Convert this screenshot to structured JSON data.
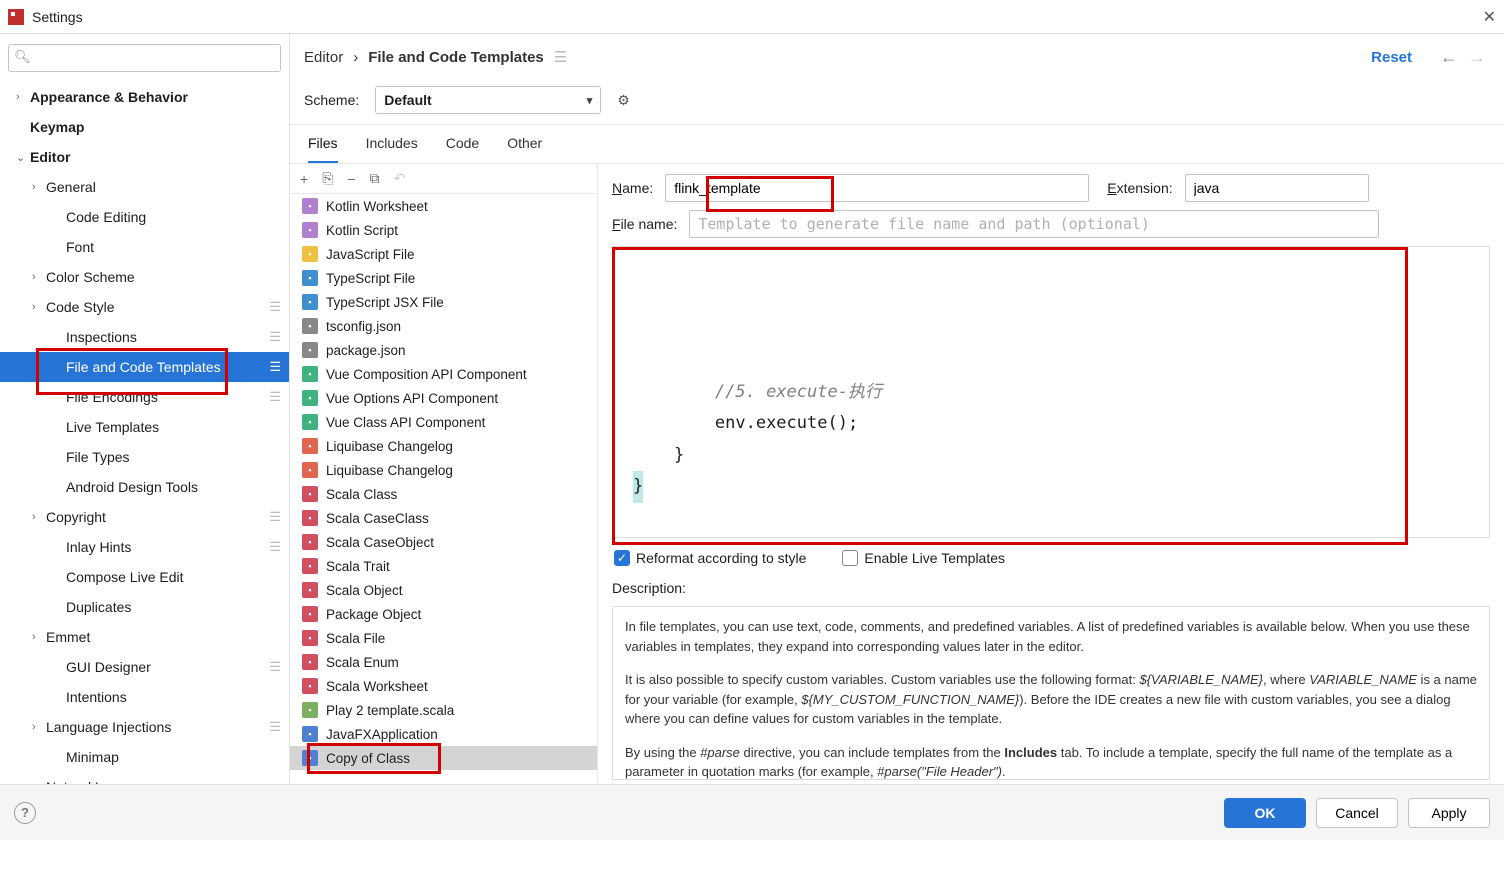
{
  "window": {
    "title": "Settings",
    "close": "✕"
  },
  "header": {
    "breadcrumb_root": "Editor",
    "breadcrumb_current": "File and Code Templates",
    "reset": "Reset"
  },
  "scheme": {
    "label": "Scheme:",
    "value": "Default"
  },
  "tabs": [
    {
      "label": "Files",
      "selected": true
    },
    {
      "label": "Includes",
      "selected": false
    },
    {
      "label": "Code",
      "selected": false
    },
    {
      "label": "Other",
      "selected": false
    }
  ],
  "sidebar": {
    "search_placeholder": "",
    "items": [
      {
        "label": "Appearance & Behavior",
        "depth": 0,
        "chev": "›",
        "bold": true
      },
      {
        "label": "Keymap",
        "depth": 0,
        "chev": "",
        "bold": true
      },
      {
        "label": "Editor",
        "depth": 0,
        "chev": "⌄",
        "bold": true
      },
      {
        "label": "General",
        "depth": 1,
        "chev": "›"
      },
      {
        "label": "Code Editing",
        "depth": 2,
        "chev": ""
      },
      {
        "label": "Font",
        "depth": 2,
        "chev": ""
      },
      {
        "label": "Color Scheme",
        "depth": 1,
        "chev": "›"
      },
      {
        "label": "Code Style",
        "depth": 1,
        "chev": "›",
        "badge": "☰"
      },
      {
        "label": "Inspections",
        "depth": 2,
        "chev": "",
        "badge": "☰"
      },
      {
        "label": "File and Code Templates",
        "depth": 2,
        "chev": "",
        "selected": true,
        "badge": "☰"
      },
      {
        "label": "File Encodings",
        "depth": 2,
        "chev": "",
        "badge": "☰"
      },
      {
        "label": "Live Templates",
        "depth": 2,
        "chev": ""
      },
      {
        "label": "File Types",
        "depth": 2,
        "chev": ""
      },
      {
        "label": "Android Design Tools",
        "depth": 2,
        "chev": ""
      },
      {
        "label": "Copyright",
        "depth": 1,
        "chev": "›",
        "badge": "☰"
      },
      {
        "label": "Inlay Hints",
        "depth": 2,
        "chev": "",
        "badge": "☰"
      },
      {
        "label": "Compose Live Edit",
        "depth": 2,
        "chev": ""
      },
      {
        "label": "Duplicates",
        "depth": 2,
        "chev": ""
      },
      {
        "label": "Emmet",
        "depth": 1,
        "chev": "›"
      },
      {
        "label": "GUI Designer",
        "depth": 2,
        "chev": "",
        "badge": "☰"
      },
      {
        "label": "Intentions",
        "depth": 2,
        "chev": ""
      },
      {
        "label": "Language Injections",
        "depth": 1,
        "chev": "›",
        "badge": "☰"
      },
      {
        "label": "Minimap",
        "depth": 2,
        "chev": ""
      },
      {
        "label": "Natural Languages",
        "depth": 1,
        "chev": "›"
      }
    ]
  },
  "template_toolbar": {
    "add": "+",
    "dup": "⎘",
    "remove": "−",
    "copy": "⧉",
    "undo": "↶"
  },
  "templates": [
    {
      "label": "Kotlin Worksheet",
      "color": "#b07fd0"
    },
    {
      "label": "Kotlin Script",
      "color": "#b07fd0"
    },
    {
      "label": "JavaScript File",
      "color": "#f0c040"
    },
    {
      "label": "TypeScript File",
      "color": "#3f8ed0"
    },
    {
      "label": "TypeScript JSX File",
      "color": "#3f8ed0"
    },
    {
      "label": "tsconfig.json",
      "color": "#888"
    },
    {
      "label": "package.json",
      "color": "#888"
    },
    {
      "label": "Vue Composition API Component",
      "color": "#3fb27f"
    },
    {
      "label": "Vue Options API Component",
      "color": "#3fb27f"
    },
    {
      "label": "Vue Class API Component",
      "color": "#3fb27f"
    },
    {
      "label": "Liquibase Changelog",
      "color": "#e06650"
    },
    {
      "label": "Liquibase Changelog",
      "color": "#e06650"
    },
    {
      "label": "Scala Class",
      "color": "#d05060"
    },
    {
      "label": "Scala CaseClass",
      "color": "#d05060"
    },
    {
      "label": "Scala CaseObject",
      "color": "#d05060"
    },
    {
      "label": "Scala Trait",
      "color": "#d05060"
    },
    {
      "label": "Scala Object",
      "color": "#d05060"
    },
    {
      "label": "Package Object",
      "color": "#d05060"
    },
    {
      "label": "Scala File",
      "color": "#d05060"
    },
    {
      "label": "Scala Enum",
      "color": "#d05060"
    },
    {
      "label": "Scala Worksheet",
      "color": "#d05060"
    },
    {
      "label": "Play 2 template.scala",
      "color": "#7bb060"
    },
    {
      "label": "JavaFXApplication",
      "color": "#5080d0"
    },
    {
      "label": "Copy of Class",
      "color": "#5080d0",
      "selected": true
    }
  ],
  "form": {
    "name_label": "Name:",
    "name_value": "flink_template",
    "ext_label": "Extension:",
    "ext_value": "java",
    "filename_label": "File name:",
    "filename_placeholder": "Template to generate file name and path (optional)"
  },
  "code": {
    "comment": "//5. execute-执行",
    "l1": "env.execute();",
    "l2": "    }",
    "l3": "}"
  },
  "checkboxes": {
    "reformat": "Reformat according to style",
    "live": "Enable Live Templates"
  },
  "desc": {
    "label": "Description:",
    "p1a": "In file templates, you can use text, code, comments, and predefined variables. A list of predefined variables is available below. When you use these variables in templates, they expand into corresponding values later in the editor.",
    "p2a": "It is also possible to specify custom variables. Custom variables use the following format: ",
    "p2var1": "${VARIABLE_NAME}",
    "p2b": ", where ",
    "p2var2": "VARIABLE_NAME",
    "p2c": " is a name for your variable (for example, ",
    "p2var3": "${MY_CUSTOM_FUNCTION_NAME}",
    "p2d": "). Before the IDE creates a new file with custom variables, you see a dialog where you can define values for custom variables in the template.",
    "p3a": "By using the ",
    "p3var1": "#parse",
    "p3b": " directive, you can include templates from the ",
    "p3bold": "Includes",
    "p3c": " tab. To include a template, specify the full name of the template as a parameter in quotation marks (for example, ",
    "p3var2": "#parse(\"File Header\")",
    "p3d": "."
  },
  "buttons": {
    "ok": "OK",
    "cancel": "Cancel",
    "apply": "Apply"
  }
}
